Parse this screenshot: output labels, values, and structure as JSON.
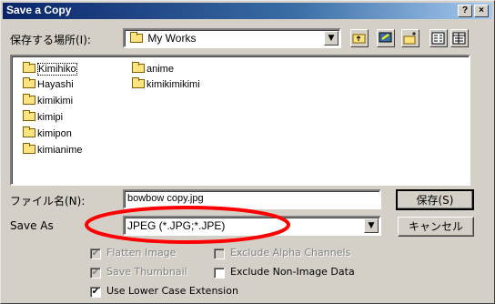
{
  "window": {
    "title": "Save a Copy",
    "help_label": "?",
    "close_label": "×"
  },
  "location": {
    "label": "保存する場所(I):",
    "value": "My Works"
  },
  "toolbar": {
    "icons": [
      "up-folder-icon",
      "desktop-icon",
      "new-folder-icon",
      "list-view-icon",
      "details-view-icon"
    ]
  },
  "files": {
    "column1": [
      "Kimihiko",
      "Hayashi",
      "kimikimi",
      "kimipi",
      "kimipon",
      "kimianime"
    ],
    "column2": [
      "anime",
      "kimikimikimi"
    ]
  },
  "filename": {
    "label": "ファイル名(N):",
    "value": "bowbow copy.jpg"
  },
  "save_as": {
    "label": "Save As",
    "value": "JPEG (*.JPG;*.JPE)"
  },
  "buttons": {
    "save": "保存(S)",
    "cancel": "キャンセル"
  },
  "options": {
    "flatten": {
      "label": "Flatten Image",
      "checked": true,
      "enabled": false
    },
    "exclude_alpha": {
      "label": "Exclude Alpha Channels",
      "checked": false,
      "enabled": false
    },
    "save_thumbnail": {
      "label": "Save Thumbnail",
      "checked": true,
      "enabled": false
    },
    "exclude_nonimage": {
      "label": "Exclude Non-Image Data",
      "checked": false,
      "enabled": true
    },
    "lowercase": {
      "label": "Use Lower Case Extension",
      "checked": true,
      "enabled": true
    }
  },
  "annotation": {
    "color": "#ff0000"
  }
}
